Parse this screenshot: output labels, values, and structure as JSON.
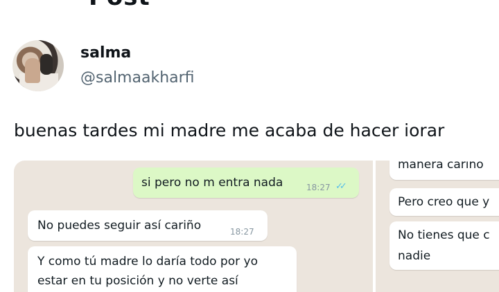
{
  "header": {
    "title": "Post"
  },
  "author": {
    "display_name": "salma",
    "handle": "@salmaakharfi"
  },
  "tweet": {
    "text": "buenas tardes mi madre me acaba de hacer iorar"
  },
  "chat_left": {
    "outgoing": {
      "text": "si pero no m entra nada",
      "time": "18:27",
      "ticks": "✓✓"
    },
    "incoming1": {
      "text": "No puedes seguir así cariño",
      "time": "18:27"
    },
    "incoming2": {
      "line1": "Y como tú madre lo daría todo por yo",
      "line2": "estar en tu posición y no verte así"
    }
  },
  "chat_right": {
    "msg1": "manera cariño",
    "msg2": "Pero creo que y",
    "msg3_line1": "No tienes que c",
    "msg3_line2": "nadie"
  }
}
